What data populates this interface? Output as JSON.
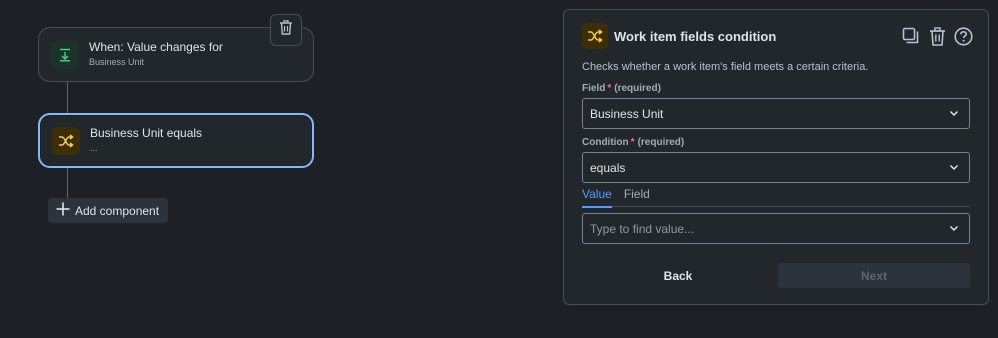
{
  "canvas": {
    "trigger_node": {
      "title": "When: Value changes for",
      "subtitle": "Business Unit",
      "icon": "download-arrow-icon"
    },
    "condition_node": {
      "title": "Business Unit equals",
      "subtitle": "...",
      "icon": "shuffle-icon"
    },
    "delete_icon": "trash-icon",
    "add_component_label": "Add component"
  },
  "panel": {
    "title": "Work item fields condition",
    "description": "Checks whether a work item's field meets a certain criteria.",
    "icons": [
      "copy-icon",
      "trash-icon",
      "help-icon"
    ],
    "field": {
      "label": "Field",
      "required_marker": "*",
      "hint": "(required)",
      "value": "Business Unit"
    },
    "condition": {
      "label": "Condition",
      "required_marker": "*",
      "hint": "(required)",
      "value": "equals"
    },
    "tabs": [
      {
        "label": "Value",
        "active": true
      },
      {
        "label": "Field",
        "active": false
      }
    ],
    "value_input": {
      "placeholder": "Type to find value..."
    },
    "back_label": "Back",
    "next_label": "Next"
  },
  "colors": {
    "background": "#1d2125",
    "accent": "#579dff",
    "selected_border": "#85b8ff",
    "trigger_icon": "#4bce97",
    "condition_icon": "#f5cd47",
    "required": "#f87168"
  }
}
